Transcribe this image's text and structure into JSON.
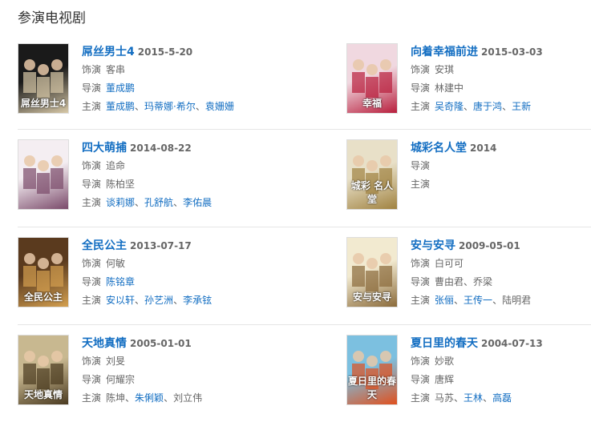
{
  "section": {
    "title": "参演电视剧"
  },
  "labels": {
    "role": "饰演",
    "director": "导演",
    "cast": "主演"
  },
  "shows": [
    {
      "title": "屌丝男士4",
      "date": "2015-5-20",
      "role": "客串",
      "director": [
        {
          "name": "董成鹏",
          "link": true
        }
      ],
      "cast": [
        {
          "name": "董成鹏",
          "link": true
        },
        {
          "name": "玛蒂娜·希尔",
          "link": true
        },
        {
          "name": "袁姗姗",
          "link": true
        }
      ],
      "poster_caption": "屌丝男士4",
      "poster_colors": [
        "#1a1a1a",
        "#d8c9a8"
      ]
    },
    {
      "title": "向着幸福前进",
      "date": "2015-03-03",
      "role": "安琪",
      "director": [
        {
          "name": "林建中",
          "link": false
        }
      ],
      "cast": [
        {
          "name": "吴奇隆",
          "link": true
        },
        {
          "name": "唐于鸿",
          "link": true
        },
        {
          "name": "王新",
          "link": true
        }
      ],
      "poster_caption": "幸福",
      "poster_colors": [
        "#f0d8e0",
        "#b81e3c"
      ]
    },
    {
      "title": "四大萌捕",
      "date": "2014-08-22",
      "role": "追命",
      "director": [
        {
          "name": "陈柏坚",
          "link": false
        }
      ],
      "cast": [
        {
          "name": "谈莉娜",
          "link": true
        },
        {
          "name": "孔舒航",
          "link": true
        },
        {
          "name": "李佑晨",
          "link": true
        }
      ],
      "poster_caption": "",
      "poster_colors": [
        "#f4eef2",
        "#7a4a6a"
      ]
    },
    {
      "title": "城彩名人堂",
      "date": "2014",
      "role": "",
      "director": [],
      "cast": [],
      "poster_caption": "城彩 名人堂",
      "poster_colors": [
        "#e8e0c8",
        "#a08240"
      ]
    },
    {
      "title": "全民公主",
      "date": "2013-07-17",
      "role": "何敏",
      "director": [
        {
          "name": "陈铭章",
          "link": true
        }
      ],
      "cast": [
        {
          "name": "安以轩",
          "link": true
        },
        {
          "name": "孙艺洲",
          "link": true
        },
        {
          "name": "李承铉",
          "link": true
        }
      ],
      "poster_caption": "全民公主",
      "poster_colors": [
        "#5a3a1e",
        "#d4a050"
      ]
    },
    {
      "title": "安与安寻",
      "date": "2009-05-01",
      "role": "白可可",
      "director": [
        {
          "name": "曹由君",
          "link": false
        },
        {
          "name": "乔梁",
          "link": false
        }
      ],
      "cast": [
        {
          "name": "张俪",
          "link": true
        },
        {
          "name": "王传一",
          "link": true
        },
        {
          "name": "陆明君",
          "link": false
        }
      ],
      "poster_caption": "安与安寻",
      "poster_colors": [
        "#f2ead0",
        "#8a6a3a"
      ]
    },
    {
      "title": "天地真情",
      "date": "2005-01-01",
      "role": "刘旻",
      "director": [
        {
          "name": "何耀宗",
          "link": false
        }
      ],
      "cast": [
        {
          "name": "陈坤",
          "link": false
        },
        {
          "name": "朱俐颖",
          "link": true
        },
        {
          "name": "刘立伟",
          "link": false
        }
      ],
      "poster_caption": "天地真情",
      "poster_colors": [
        "#c8b890",
        "#4a3a20"
      ]
    },
    {
      "title": "夏日里的春天",
      "date": "2004-07-13",
      "role": "妙歌",
      "director": [
        {
          "name": "唐辉",
          "link": false
        }
      ],
      "cast": [
        {
          "name": "马苏",
          "link": false
        },
        {
          "name": "王林",
          "link": true
        },
        {
          "name": "高磊",
          "link": true
        }
      ],
      "poster_caption": "夏日里的春天",
      "poster_colors": [
        "#7cc0e0",
        "#e0501e"
      ]
    }
  ]
}
